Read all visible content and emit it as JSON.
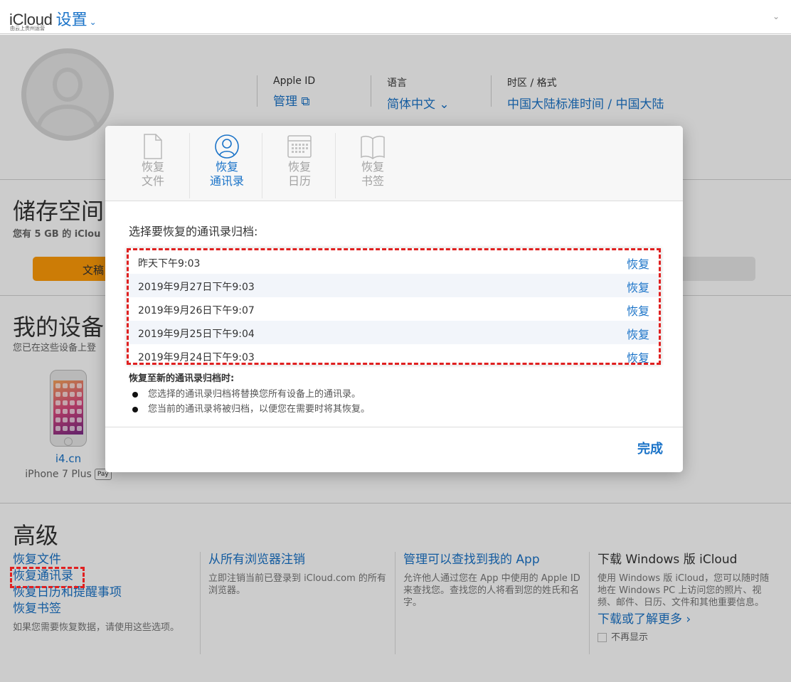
{
  "header": {
    "brand": "iCloud",
    "settings_label": "设置",
    "brand_sub": "由云上贵州运营"
  },
  "profile": {
    "apple_id_label": "Apple ID",
    "apple_id_manage": "管理",
    "language_label": "语言",
    "language_value": "简体中文",
    "timezone_label": "时区 / 格式",
    "timezone_value": "中国大陆标准时间 / 中国大陆"
  },
  "storage": {
    "title": "储存空间",
    "summary": "您有 5 GB 的 iClou",
    "bar_label": "文稿"
  },
  "devices": {
    "title": "我的设备",
    "summary": "您已在这些设备上登",
    "items": [
      {
        "name": "i4.cn",
        "model": "iPhone 7 Plus",
        "badge": " Pay"
      }
    ]
  },
  "advanced": {
    "title": "高级",
    "col1": {
      "links": [
        "恢复文件",
        "恢复通讯录",
        "恢复日历和提醒事项",
        "恢复书签"
      ],
      "desc": "如果您需要恢复数据，请使用这些选项。"
    },
    "col2": {
      "link": "从所有浏览器注销",
      "desc": "立即注销当前已登录到 iCloud.com 的所有浏览器。"
    },
    "col3": {
      "link": "管理可以查找到我的 App",
      "desc": "允许他人通过您在 App 中使用的 Apple ID 来查找您。查找您的人将看到您的姓氏和名字。"
    },
    "col4": {
      "title": "下载 Windows 版 iCloud",
      "desc": "使用 Windows 版 iCloud，您可以随时随地在 Windows PC 上访问您的照片、视频、邮件、日历、文件和其他重要信息。",
      "link": "下载或了解更多",
      "checkbox_label": "不再显示"
    }
  },
  "modal": {
    "tabs": [
      {
        "line1": "恢复",
        "line2": "文件",
        "icon": "document-icon",
        "active": false
      },
      {
        "line1": "恢复",
        "line2": "通讯录",
        "icon": "contacts-icon",
        "active": true
      },
      {
        "line1": "恢复",
        "line2": "日历",
        "icon": "calendar-icon",
        "active": false
      },
      {
        "line1": "恢复",
        "line2": "书签",
        "icon": "bookmark-icon",
        "active": false
      }
    ],
    "title": "选择要恢复的通讯录归档:",
    "archives": [
      {
        "date": "昨天下午9:03",
        "action": "恢复"
      },
      {
        "date": "2019年9月27日下午9:03",
        "action": "恢复"
      },
      {
        "date": "2019年9月26日下午9:07",
        "action": "恢复"
      },
      {
        "date": "2019年9月25日下午9:04",
        "action": "恢复"
      },
      {
        "date": "2019年9月24日下午9:03",
        "action": "恢复"
      }
    ],
    "notes_heading": "恢复至新的通讯录归档时:",
    "notes": [
      "您选择的通讯录归档将替换您所有设备上的通讯录。",
      "您当前的通讯录将被归档，以便您在需要时将其恢复。"
    ],
    "done_label": "完成"
  },
  "colors": {
    "accent": "#1a73c8",
    "storage_fill": "#ff9b08",
    "highlight_border": "#e02020"
  }
}
